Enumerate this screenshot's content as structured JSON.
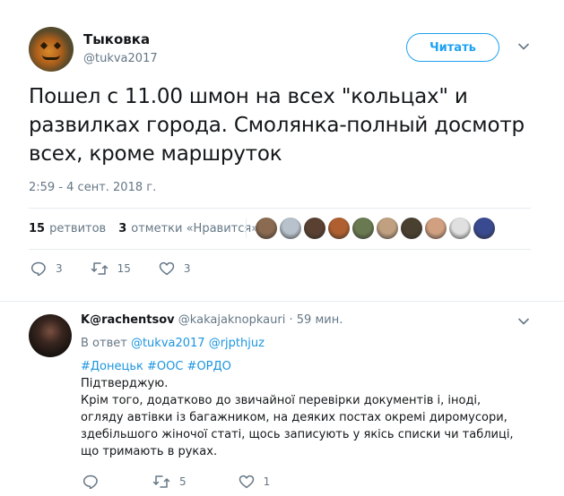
{
  "tweet": {
    "author_name": "Тыковка",
    "author_handle": "@tukva2017",
    "follow_label": "Читать",
    "text": "Пошел с 11.00 шмон на всех \"кольцах\" и развилках города. Смолянка-полный досмотр всех, кроме маршруток",
    "timestamp": "2:59 - 4 сент. 2018 г.",
    "retweets_count": "15",
    "retweets_label": "ретвитов",
    "likes_count": "3",
    "likes_label": "отметки «Нравится»",
    "liker_avatar_colors": [
      "#8a6a50",
      "#b8c2cc",
      "#5a4030",
      "#b06030",
      "#6a7a50",
      "#c0a080",
      "#4a4030",
      "#d0a080",
      "#e0e0e0",
      "#3a4a90"
    ],
    "actions": {
      "replies": "3",
      "retweets": "15",
      "likes": "3"
    }
  },
  "reply": {
    "author_name": "K@rachentsov",
    "author_handle": "@kakajaknopkauri",
    "separator": "·",
    "time": "59 мин.",
    "reply_to_prefix": "В ответ",
    "reply_to_user1": "@tukva2017",
    "reply_to_user2": "@rjpthjuz",
    "hashtags": "#Донецьк #ООС #ОРДО",
    "line1": "Підтверджую.",
    "body": "Крім того, додатково до звичайної перевірки документів і, іноді, огляду автівки із багажником, на деяких постах окремі диромусори, здебільшого жіночої статі, щось записують у якісь списки чи таблиці, що тримають в руках.",
    "actions": {
      "replies": "",
      "retweets": "5",
      "likes": "1"
    }
  },
  "colors": {
    "accent": "#1da1f2",
    "link": "#1b95e0",
    "muted": "#657786",
    "text": "#14171a"
  }
}
